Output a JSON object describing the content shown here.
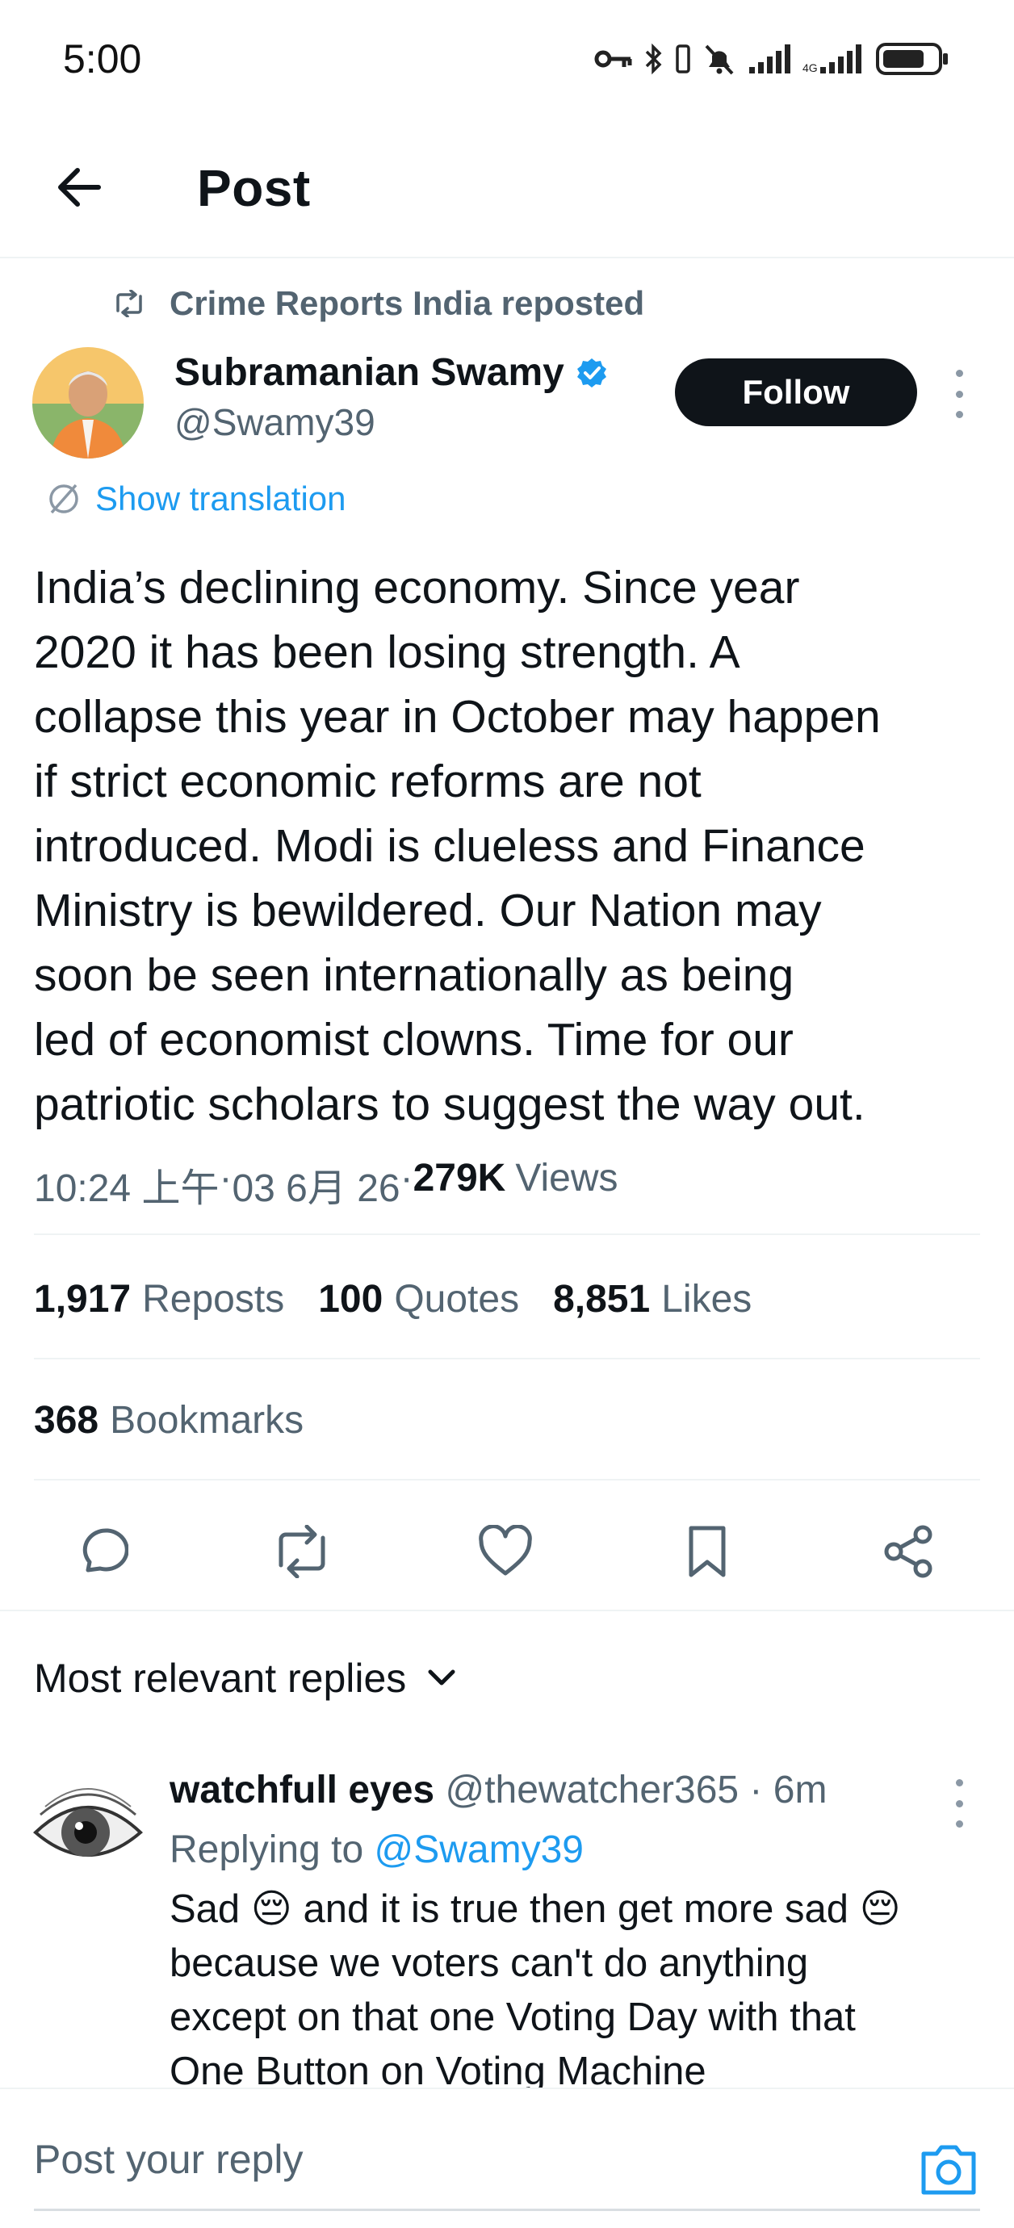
{
  "status_bar": {
    "time": "5:00",
    "icons": [
      "key-icon",
      "bluetooth-icon",
      "vibrate-icon",
      "mute-icon",
      "signal-icon",
      "signal-icon",
      "battery-icon"
    ]
  },
  "header": {
    "title": "Post",
    "back_icon": "arrow-left-icon"
  },
  "post": {
    "repost_label": "Crime Reports India reposted",
    "author_name": "Subramanian Swamy",
    "author_handle": "@Swamy39",
    "verified": true,
    "follow_label": "Follow",
    "show_translation": "Show translation",
    "text_lines": [
      "India’s declining economy. Since year",
      "2020 it has been losing strength. A",
      "collapse this year in October may happen",
      "if strict economic reforms are not",
      "introduced. Modi is clueless and Finance",
      "Ministry is bewildered. Our Nation may",
      "soon be seen internationally as being",
      "led of economist clowns. Time for our",
      "patriotic scholars to suggest the way out."
    ],
    "time": "10:24 上午",
    "date": "03 6月 26",
    "views_count": "279K",
    "views_label": "Views",
    "separator": " · "
  },
  "stats": {
    "reposts_count": "1,917",
    "reposts_label": "Reposts",
    "quotes_count": "100",
    "quotes_label": "Quotes",
    "likes_count": "8,851",
    "likes_label": "Likes",
    "bookmarks_count": "368",
    "bookmarks_label": "Bookmarks"
  },
  "actions": [
    "reply-icon",
    "repost-icon",
    "like-icon",
    "bookmark-icon",
    "share-icon"
  ],
  "replies": {
    "header": "Most relevant replies",
    "items": [
      {
        "name": "watchfull eyes",
        "handle": "@thewatcher365",
        "age": "6m",
        "replying_prefix": "Replying to ",
        "replying_to": "@Swamy39",
        "lines": [
          "Sad 😔 and it is true then get more sad 😔",
          "because we voters can't do anything",
          "except on that one Voting Day with that",
          "One Button on Voting Machine"
        ]
      }
    ]
  },
  "composer": {
    "placeholder": "Post your reply"
  },
  "colors": {
    "accent": "#1d9bf0",
    "text": "#0f1419",
    "secondary": "#536471",
    "divider": "#eff3f4"
  }
}
